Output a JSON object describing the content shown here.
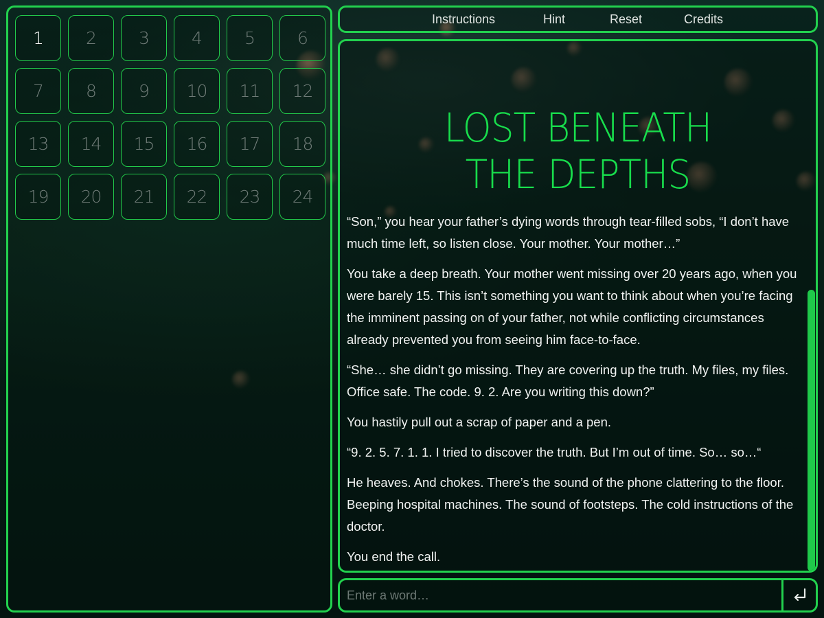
{
  "menu": {
    "instructions": "Instructions",
    "hint": "Hint",
    "reset": "Reset",
    "credits": "Credits"
  },
  "levels": [
    "1",
    "2",
    "3",
    "4",
    "5",
    "6",
    "7",
    "8",
    "9",
    "10",
    "11",
    "12",
    "13",
    "14",
    "15",
    "16",
    "17",
    "18",
    "19",
    "20",
    "21",
    "22",
    "23",
    "24"
  ],
  "current_level": "1",
  "title": {
    "line1": "Lost Beneath",
    "line2": "The Depths"
  },
  "story": [
    "“Son,” you hear your father’s dying words through tear-filled sobs, “I don’t have much time left, so listen close. Your mother. Your mother…”",
    "You take a deep breath. Your mother went missing over 20 years ago, when you were barely 15. This isn’t something you want to think about when you’re facing the imminent passing on of your father, not while conflicting circumstances already prevented you from seeing him face-to-face.",
    "“She… she didn’t go missing. They are covering up the truth. My files, my files. Office safe. The code. 9. 2. Are you writing this down?”",
    "You hastily pull out a scrap of paper and a pen.",
    "“9. 2. 5. 7. 1. 1. I tried to discover the truth. But I’m out of time. So… so…“",
    "He heaves. And chokes. There’s the sound of the phone clattering to the floor. Beeping hospital machines. The sound of footsteps. The cold instructions of the doctor.",
    "You end the call."
  ],
  "input": {
    "placeholder": "Enter a word…"
  },
  "icons": {
    "submit": "enter-return-icon"
  },
  "colors": {
    "accent": "#22d14e",
    "title": "#18dd4c",
    "text": "#f1f3f2",
    "muted": "#6f7b77"
  }
}
